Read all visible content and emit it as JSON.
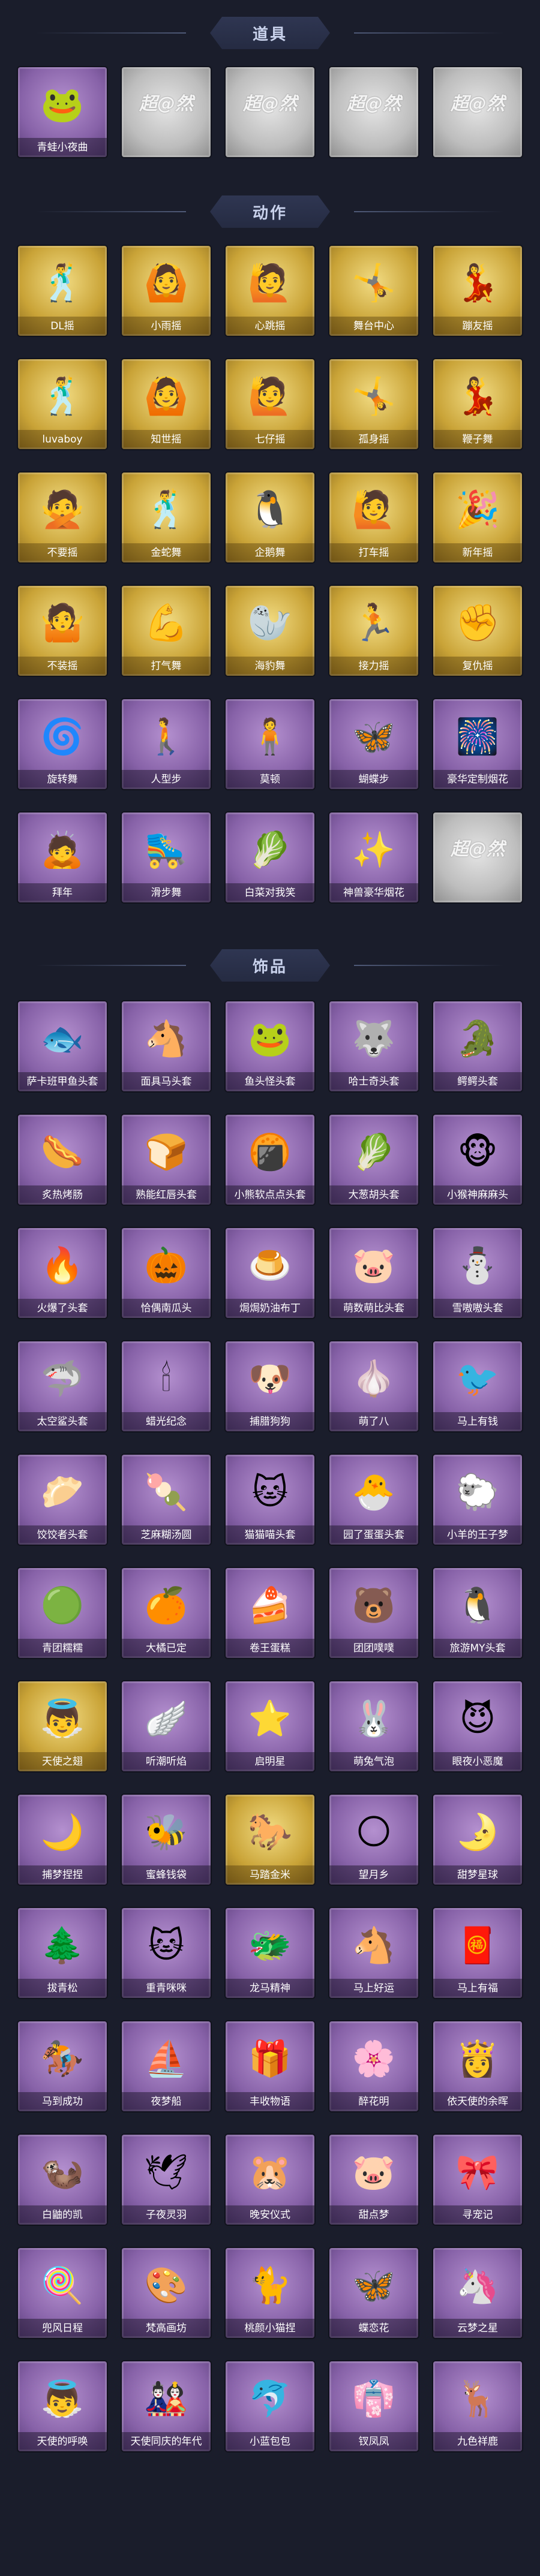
{
  "sections": [
    {
      "title": "道具",
      "items": [
        {
          "label": "青蛙小夜曲",
          "style": "purple",
          "icon": "🐸"
        },
        {
          "label": "",
          "style": "gray",
          "icon": "超@然"
        },
        {
          "label": "",
          "style": "gray",
          "icon": "超@然"
        },
        {
          "label": "",
          "style": "gray",
          "icon": "超@然"
        },
        {
          "label": "",
          "style": "gray",
          "icon": "超@然"
        }
      ]
    },
    {
      "title": "动作",
      "items": [
        {
          "label": "DL摇",
          "style": "gold",
          "icon": "🕺"
        },
        {
          "label": "小雨摇",
          "style": "gold",
          "icon": "🙆"
        },
        {
          "label": "心跳摇",
          "style": "gold",
          "icon": "🙋"
        },
        {
          "label": "舞台中心",
          "style": "gold",
          "icon": "🤸"
        },
        {
          "label": "蹦友摇",
          "style": "gold",
          "icon": "💃"
        },
        {
          "label": "luvaboy",
          "style": "gold",
          "icon": "🕺"
        },
        {
          "label": "知世摇",
          "style": "gold",
          "icon": "🙆"
        },
        {
          "label": "七仔摇",
          "style": "gold",
          "icon": "🙋"
        },
        {
          "label": "孤身摇",
          "style": "gold",
          "icon": "🤸"
        },
        {
          "label": "鞭子舞",
          "style": "gold",
          "icon": "💃"
        },
        {
          "label": "不要摇",
          "style": "gold",
          "icon": "🙅"
        },
        {
          "label": "金蛇舞",
          "style": "gold",
          "icon": "🕺"
        },
        {
          "label": "企鹅舞",
          "style": "gold",
          "icon": "🐧"
        },
        {
          "label": "打车摇",
          "style": "gold",
          "icon": "🙋"
        },
        {
          "label": "新年摇",
          "style": "gold",
          "icon": "🎉"
        },
        {
          "label": "不装摇",
          "style": "gold",
          "icon": "🤷"
        },
        {
          "label": "打气舞",
          "style": "gold",
          "icon": "💪"
        },
        {
          "label": "海豹舞",
          "style": "gold",
          "icon": "🦭"
        },
        {
          "label": "接力摇",
          "style": "gold",
          "icon": "🏃"
        },
        {
          "label": "复仇摇",
          "style": "gold",
          "icon": "✊"
        },
        {
          "label": "旋转舞",
          "style": "purple",
          "icon": "🌀"
        },
        {
          "label": "人型步",
          "style": "purple",
          "icon": "🚶"
        },
        {
          "label": "莫顿",
          "style": "purple",
          "icon": "🧍"
        },
        {
          "label": "蝴蝶步",
          "style": "purple",
          "icon": "🦋"
        },
        {
          "label": "豪华定制烟花",
          "style": "purple",
          "icon": "🎆"
        },
        {
          "label": "拜年",
          "style": "purple",
          "icon": "🙇"
        },
        {
          "label": "滑步舞",
          "style": "purple",
          "icon": "🛼"
        },
        {
          "label": "白菜对我笑",
          "style": "purple",
          "icon": "🥬"
        },
        {
          "label": "神兽豪华烟花",
          "style": "purple",
          "icon": "✨"
        },
        {
          "label": "",
          "style": "gray",
          "icon": "超@然"
        }
      ]
    },
    {
      "title": "饰品",
      "items": [
        {
          "label": "萨卡班甲鱼头套",
          "style": "purple",
          "icon": "🐟"
        },
        {
          "label": "面具马头套",
          "style": "purple",
          "icon": "🐴"
        },
        {
          "label": "鱼头怪头套",
          "style": "purple",
          "icon": "🐸"
        },
        {
          "label": "哈士奇头套",
          "style": "purple",
          "icon": "🐺"
        },
        {
          "label": "鳄鳄头套",
          "style": "purple",
          "icon": "🐊"
        },
        {
          "label": "炙热烤肠",
          "style": "purple",
          "icon": "🌭"
        },
        {
          "label": "熟能红唇头套",
          "style": "purple",
          "icon": "🍞"
        },
        {
          "label": "小熊软点点头套",
          "style": "purple",
          "icon": "🍘"
        },
        {
          "label": "大葱胡头套",
          "style": "purple",
          "icon": "🥬"
        },
        {
          "label": "小猴神麻麻头",
          "style": "purple",
          "icon": "🐵"
        },
        {
          "label": "火爆了头套",
          "style": "purple",
          "icon": "🔥"
        },
        {
          "label": "恰偶南瓜头",
          "style": "purple",
          "icon": "🎃"
        },
        {
          "label": "焗焗奶油布丁",
          "style": "purple",
          "icon": "🍮"
        },
        {
          "label": "萌数萌比头套",
          "style": "purple",
          "icon": "🐷"
        },
        {
          "label": "雪嗷嗷头套",
          "style": "purple",
          "icon": "⛄"
        },
        {
          "label": "太空鲨头套",
          "style": "purple",
          "icon": "🦈"
        },
        {
          "label": "蜡光纪念",
          "style": "purple",
          "icon": "🕯"
        },
        {
          "label": "捕腊狗狗",
          "style": "purple",
          "icon": "🐶"
        },
        {
          "label": "萌了八",
          "style": "purple",
          "icon": "🧄"
        },
        {
          "label": "马上有钱",
          "style": "purple",
          "icon": "🐦"
        },
        {
          "label": "饺饺者头套",
          "style": "purple",
          "icon": "🥟"
        },
        {
          "label": "芝麻糊汤圆",
          "style": "purple",
          "icon": "🍡"
        },
        {
          "label": "猫猫喵头套",
          "style": "purple",
          "icon": "🐱"
        },
        {
          "label": "园了蛋蛋头套",
          "style": "purple",
          "icon": "🐣"
        },
        {
          "label": "小羊的王子梦",
          "style": "purple",
          "icon": "🐑"
        },
        {
          "label": "青团糯糯",
          "style": "purple",
          "icon": "🟢"
        },
        {
          "label": "大橘已定",
          "style": "purple",
          "icon": "🍊"
        },
        {
          "label": "卷王蛋糕",
          "style": "purple",
          "icon": "🍰"
        },
        {
          "label": "团团噗噗",
          "style": "purple",
          "icon": "🐻"
        },
        {
          "label": "旅游MY头套",
          "style": "purple",
          "icon": "🐧"
        },
        {
          "label": "天使之翅",
          "style": "gold",
          "icon": "👼"
        },
        {
          "label": "听潮听焰",
          "style": "purple",
          "icon": "🪽"
        },
        {
          "label": "启明星",
          "style": "purple",
          "icon": "⭐"
        },
        {
          "label": "萌兔气泡",
          "style": "purple",
          "icon": "🐰"
        },
        {
          "label": "眼夜小恶魔",
          "style": "purple",
          "icon": "😈"
        },
        {
          "label": "捕梦捏捏",
          "style": "purple",
          "icon": "🌙"
        },
        {
          "label": "蜜蜂钱袋",
          "style": "purple",
          "icon": "🐝"
        },
        {
          "label": "马踏金米",
          "style": "gold",
          "icon": "🐎"
        },
        {
          "label": "望月乡",
          "style": "purple",
          "icon": "🌕"
        },
        {
          "label": "甜梦星球",
          "style": "purple",
          "icon": "🌛"
        },
        {
          "label": "拔青松",
          "style": "purple",
          "icon": "🌲"
        },
        {
          "label": "重青咪咪",
          "style": "purple",
          "icon": "🐱"
        },
        {
          "label": "龙马精神",
          "style": "purple",
          "icon": "🐲"
        },
        {
          "label": "马上好运",
          "style": "purple",
          "icon": "🐴"
        },
        {
          "label": "马上有福",
          "style": "purple",
          "icon": "🧧"
        },
        {
          "label": "马到成功",
          "style": "purple",
          "icon": "🏇"
        },
        {
          "label": "夜梦船",
          "style": "purple",
          "icon": "⛵"
        },
        {
          "label": "丰收物语",
          "style": "purple",
          "icon": "🎁"
        },
        {
          "label": "醉花明",
          "style": "purple",
          "icon": "🌸"
        },
        {
          "label": "依天使的余晖",
          "style": "purple",
          "icon": "👸"
        },
        {
          "label": "白鼬的凯",
          "style": "purple",
          "icon": "🦦"
        },
        {
          "label": "子夜灵羽",
          "style": "purple",
          "icon": "🕊"
        },
        {
          "label": "晚安仪式",
          "style": "purple",
          "icon": "🐹"
        },
        {
          "label": "甜点梦",
          "style": "purple",
          "icon": "🐷"
        },
        {
          "label": "寻宠记",
          "style": "purple",
          "icon": "🎀"
        },
        {
          "label": "兜风日程",
          "style": "purple",
          "icon": "🍭"
        },
        {
          "label": "梵高画坊",
          "style": "purple",
          "icon": "🎨"
        },
        {
          "label": "桃颜小猫捏",
          "style": "purple",
          "icon": "🐈"
        },
        {
          "label": "蝶恋花",
          "style": "purple",
          "icon": "🦋"
        },
        {
          "label": "云梦之星",
          "style": "purple",
          "icon": "🦄"
        },
        {
          "label": "天使的呼唤",
          "style": "purple",
          "icon": "👼"
        },
        {
          "label": "天使同庆的年代",
          "style": "purple",
          "icon": "🎎"
        },
        {
          "label": "小蓝包包",
          "style": "purple",
          "icon": "🐬"
        },
        {
          "label": "钗凤凤",
          "style": "purple",
          "icon": "👘"
        },
        {
          "label": "九色祥鹿",
          "style": "purple",
          "icon": "🦌"
        }
      ]
    }
  ]
}
